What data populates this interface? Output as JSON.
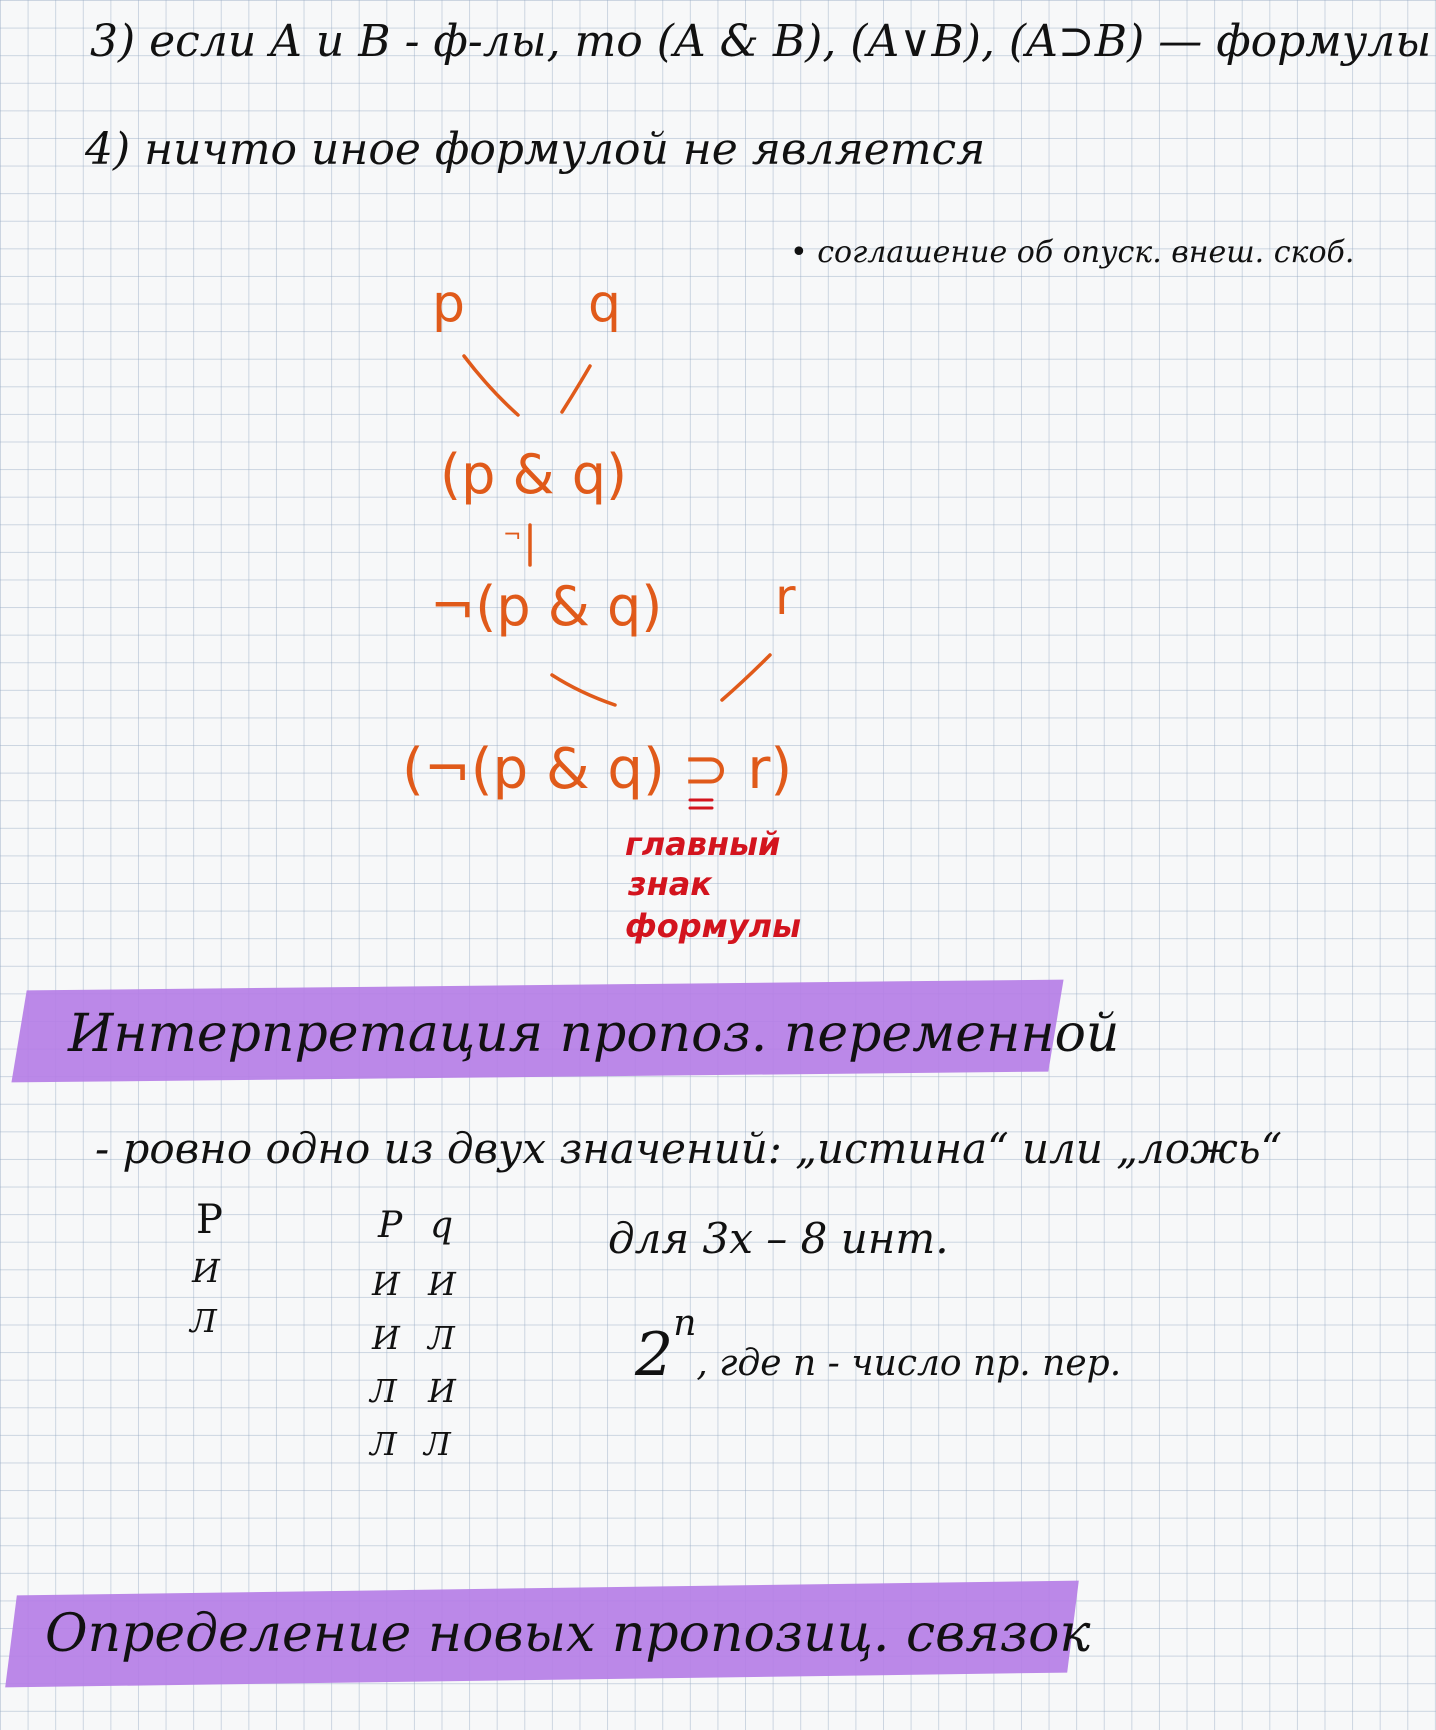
{
  "page": {
    "background_color": "#f7f8f9",
    "grid_color": "#aebdd0"
  },
  "colors": {
    "black_ink": "#111111",
    "orange_ink": "#e05a1a",
    "red_ink": "#d3141e",
    "highlight": "#b57ee6"
  },
  "rules": {
    "rule3": "3) если A и B - ф-лы, то (A & B), (A∨B), (A⊃B) — формулы",
    "rule4": "4) ничто иное формулой не является",
    "note": "• соглашение об опуск. внеш. скоб."
  },
  "tree": {
    "p": "p",
    "q": "q",
    "p_and_q": "(p & q)",
    "neg_symbol": "¬",
    "neg_p_and_q": "¬(p & q)",
    "r": "r",
    "formula": "(¬(p & q) ⊃ r)",
    "main_sign_label": [
      "главный",
      "знак",
      "формулы"
    ]
  },
  "section1": {
    "heading": "Интерпретация пропоз. переменной",
    "bullet": "- ровно одно из двух значений: „истина“ или „ложь“"
  },
  "truth_tables": {
    "one_var": {
      "header": "P",
      "rows": [
        "И",
        "Л"
      ]
    },
    "two_var": {
      "headers": [
        "P",
        "q"
      ],
      "rows": [
        [
          "И",
          "И"
        ],
        [
          "И",
          "Л"
        ],
        [
          "Л",
          "И"
        ],
        [
          "Л",
          "Л"
        ]
      ]
    }
  },
  "notes": {
    "three_vars": "для 3х – 8 инт.",
    "formula_base": "2",
    "formula_exp": "n",
    "formula_text": ", где n - число пр. пер."
  },
  "section2": {
    "heading": "Определение новых пропозиц. связок"
  }
}
